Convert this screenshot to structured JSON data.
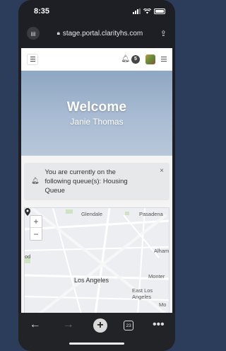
{
  "status_bar": {
    "time": "8:35"
  },
  "browser": {
    "url": "stage.portal.clarityhs.com",
    "tab_count": "23"
  },
  "app_header": {
    "notification_count": "5"
  },
  "hero": {
    "title": "Welcome",
    "user_name": "Janie Thomas"
  },
  "alert": {
    "message": "You are currently on the following queue(s): Housing Queue",
    "close_label": "×"
  },
  "map": {
    "zoom_in": "+",
    "zoom_out": "−",
    "labels": {
      "glendale": "Glendale",
      "pasadena": "Pasadena",
      "alhambra": "Alham",
      "monterey": "Monter",
      "los_angeles": "Los Angeles",
      "east_los_angeles": "East Los Angeles",
      "mo": "Mo",
      "od": "od"
    }
  },
  "colors": {
    "page_bg": "#2c3d5b",
    "hero_gradient_top": "#8ea6c2",
    "alert_bg": "#e6e8ea",
    "browser_chrome": "#1e1f24"
  },
  "icons": {
    "back": "arrow-left-icon",
    "forward": "arrow-right-icon",
    "new_tab": "plus-icon",
    "tabs": "tabs-icon",
    "more": "more-dots-icon"
  }
}
